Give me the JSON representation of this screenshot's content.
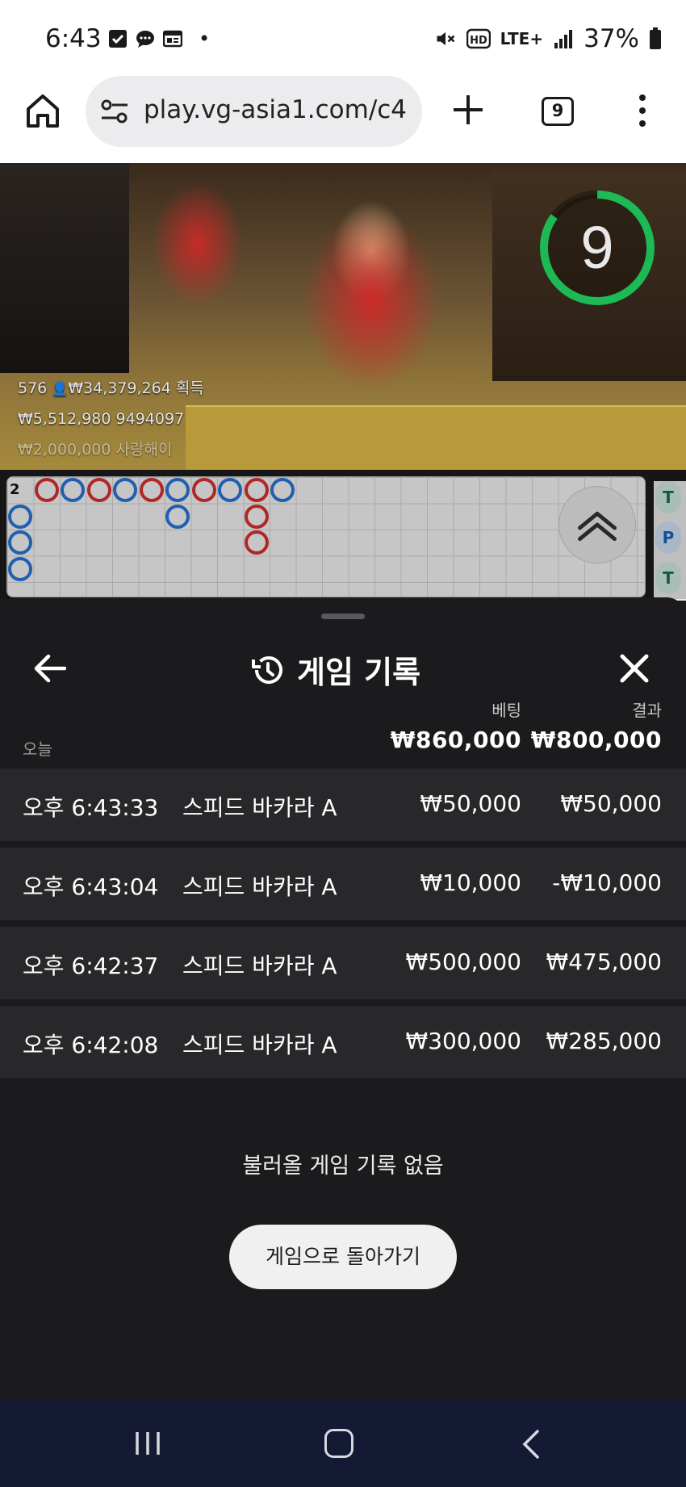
{
  "status_bar": {
    "time": "6:43",
    "dot": "•",
    "network": "LTE+",
    "battery": "37%",
    "icons": [
      "check-box-icon",
      "chat-bubble-icon",
      "news-icon",
      "mute-icon",
      "hd-voice-icon",
      "lte-plus-icon",
      "signal-icon",
      "battery-icon"
    ]
  },
  "browser": {
    "url": "play.vg-asia1.com/c4",
    "tab_count": "9"
  },
  "stream": {
    "countdown": "9",
    "countdown_progress": 0.85,
    "players_count": "576",
    "win_text": "₩34,379,264 획득",
    "line2": "₩5,512,980 9494097",
    "line3": "₩2,000,000 사랑해이",
    "accent_green": "#1db954"
  },
  "roadmap": {
    "shoe_count": "2",
    "side_tabs": [
      "T",
      "P",
      "T"
    ],
    "colors": {
      "banker": "#d63030",
      "player": "#2a74d6"
    }
  },
  "history": {
    "title": "게임 기록",
    "col_bet": "베팅",
    "col_result": "결과",
    "group_label": "오늘",
    "total_bet": "₩860,000",
    "total_result": "₩800,000",
    "rows": [
      {
        "time": "오후 6:43:33",
        "game": "스피드 바카라 A",
        "bet": "₩50,000",
        "result": "₩50,000"
      },
      {
        "time": "오후 6:43:04",
        "game": "스피드 바카라 A",
        "bet": "₩10,000",
        "result": "-₩10,000"
      },
      {
        "time": "오후 6:42:37",
        "game": "스피드 바카라 A",
        "bet": "₩500,000",
        "result": "₩475,000"
      },
      {
        "time": "오후 6:42:08",
        "game": "스피드 바카라 A",
        "bet": "₩300,000",
        "result": "₩285,000"
      }
    ],
    "empty_message": "불러올 게임 기록 없음",
    "return_button": "게임으로 돌아가기"
  }
}
